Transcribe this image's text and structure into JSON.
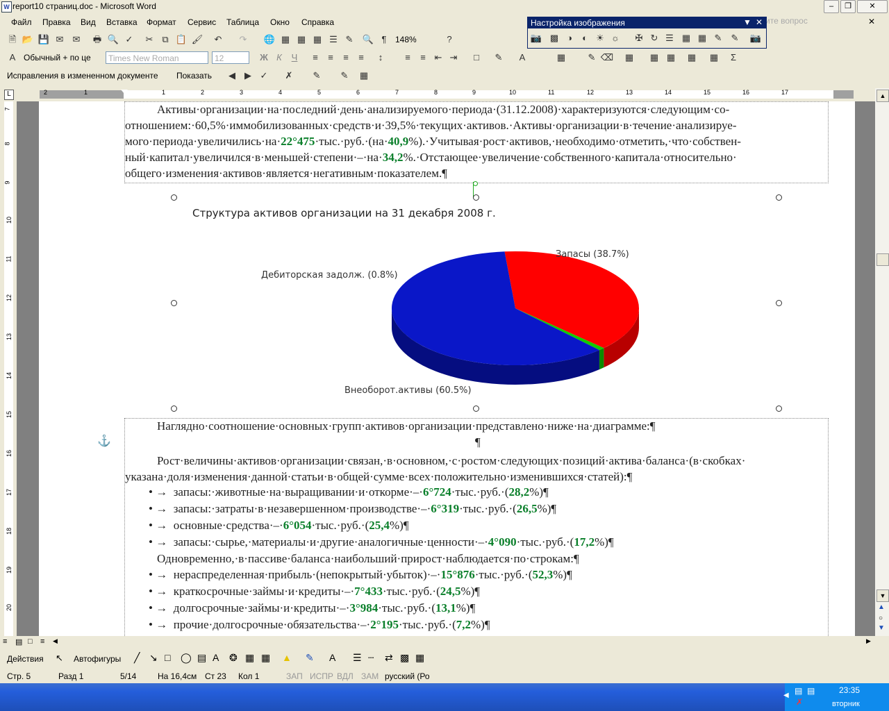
{
  "window": {
    "title": "report10 страниц.doc - Microsoft Word"
  },
  "menu": [
    "Файл",
    "Правка",
    "Вид",
    "Вставка",
    "Формат",
    "Сервис",
    "Таблица",
    "Окно",
    "Справка"
  ],
  "ask_placeholder": "дите вопрос",
  "toolbar_standard": {
    "zoom": "148%"
  },
  "toolbar_format": {
    "style": "Обычный + по це",
    "font": "Times New Roman",
    "size": "12"
  },
  "toolbar_review": {
    "mode": "Исправления в измененном документе",
    "show_label": "Показать"
  },
  "picture_toolbar": {
    "title": "Настройка изображения"
  },
  "ruler_h": [
    "2",
    "1",
    "1",
    "2",
    "3",
    "4",
    "5",
    "6",
    "7",
    "8",
    "9",
    "10",
    "11",
    "12",
    "13",
    "14",
    "15",
    "16",
    "17"
  ],
  "ruler_v": [
    "7",
    "8",
    "9",
    "10",
    "11",
    "12",
    "13",
    "14",
    "15",
    "16",
    "17",
    "18",
    "19",
    "20"
  ],
  "doc": {
    "para1": [
      {
        "segs": [
          {
            "t": "Активы·организации·на·последний·день·анализируемого·периода·(31.12.2008)·характеризуются·следующим·со-"
          }
        ]
      },
      {
        "segs": [
          {
            "t": "отношением:·60,5%·иммобилизованных·средств·и·39,5%·текущих·активов.·Активы·организации·в·течение·анализируе-"
          }
        ]
      },
      {
        "segs": [
          {
            "t": "мого·периода·увеличились·на·"
          },
          {
            "t": "22°475",
            "g": true
          },
          {
            "t": "·тыс.·руб.·(на·"
          },
          {
            "t": "40,9",
            "g": true
          },
          {
            "t": "%).·Учитывая·рост·активов,·необходимо·отметить,·что·собствен-"
          }
        ]
      },
      {
        "segs": [
          {
            "t": "ный·капитал·увеличился·в·меньшей·степени·–·на·"
          },
          {
            "t": "34,2",
            "g": true
          },
          {
            "t": "%.·Отстающее·увеличение·собственного·капитала·относительно·"
          }
        ]
      },
      {
        "segs": [
          {
            "t": "общего·изменения·активов·является·негативным·показателем.¶"
          }
        ]
      }
    ],
    "para2": "Наглядно·соотношение·основных·групп·активов·организации·представлено·ниже·на·диаграмме:¶",
    "empty_mark": "¶",
    "para3": [
      "Рост·величины·активов·организации·связан,·в·основном,·с·ростом·следующих·позиций·актива·баланса·(в·скобках·",
      "указана·доля·изменения·данной·статьи·в·общей·сумме·всех·положительно·изменившихся·статей):¶"
    ],
    "list1": [
      {
        "text": "запасы:·животные·на·выращивании·и·откорме·–·",
        "val": "6°724",
        "mid": "·тыс.·руб.·(",
        "pct": "28,2",
        "end": "%)¶"
      },
      {
        "text": "запасы:·затраты·в·незавершенном·производстве·–·",
        "val": "6°319",
        "mid": "·тыс.·руб.·(",
        "pct": "26,5",
        "end": "%)¶"
      },
      {
        "text": "основные·средства·–·",
        "val": "6°054",
        "mid": "·тыс.·руб.·(",
        "pct": "25,4",
        "end": "%)¶"
      },
      {
        "text": "запасы:·сырье,·материалы·и·другие·аналогичные·ценности·–·",
        "val": "4°090",
        "mid": "·тыс.·руб.·(",
        "pct": "17,2",
        "end": "%)¶"
      }
    ],
    "para4": "Одновременно,·в·пассиве·баланса·наибольший·прирост·наблюдается·по·строкам:¶",
    "list2": [
      {
        "text": "нераспределенная·прибыль·(непокрытый·убыток)·–·",
        "val": "15°876",
        "mid": "·тыс.·руб.·(",
        "pct": "52,3",
        "end": "%)¶"
      },
      {
        "text": "краткосрочные·займы·и·кредиты·–·",
        "val": "7°433",
        "mid": "·тыс.·руб.·(",
        "pct": "24,5",
        "end": "%)¶"
      },
      {
        "text": "долгосрочные·займы·и·кредиты·–·",
        "val": "3°984",
        "mid": "·тыс.·руб.·(",
        "pct": "13,1",
        "end": "%)¶"
      },
      {
        "text": "прочие·долгосрочные·обязательства·–·",
        "val": "2°195",
        "mid": "·тыс.·руб.·(",
        "pct": "7,2",
        "end": "%)¶"
      }
    ]
  },
  "chart_data": {
    "type": "pie",
    "title": "Структура активов организации на 31 декабря 2008 г.",
    "labels": [
      "Запасы (38.7%)",
      "Дебиторская задолж. (0.8%)",
      "Внеоборот.активы (60.5%)"
    ],
    "values": [
      38.7,
      0.8,
      60.5
    ],
    "colors": [
      "#ff0000",
      "#11cc00",
      "#0a17c8"
    ]
  },
  "drawing_toolbar": {
    "actions": "Действия",
    "autoshapes": "Автофигуры"
  },
  "status": {
    "page": "Стр. 5",
    "section": "Разд 1",
    "pages": "5/14",
    "at": "На 16,4см",
    "line": "Ст 23",
    "col": "Кол 1",
    "rec": "ЗАП",
    "trk": "ИСПР",
    "ext": "ВДЛ",
    "ovr": "ЗАМ",
    "lang": "русский (Ро"
  },
  "tray": {
    "time": "23:35",
    "day": "вторник"
  }
}
